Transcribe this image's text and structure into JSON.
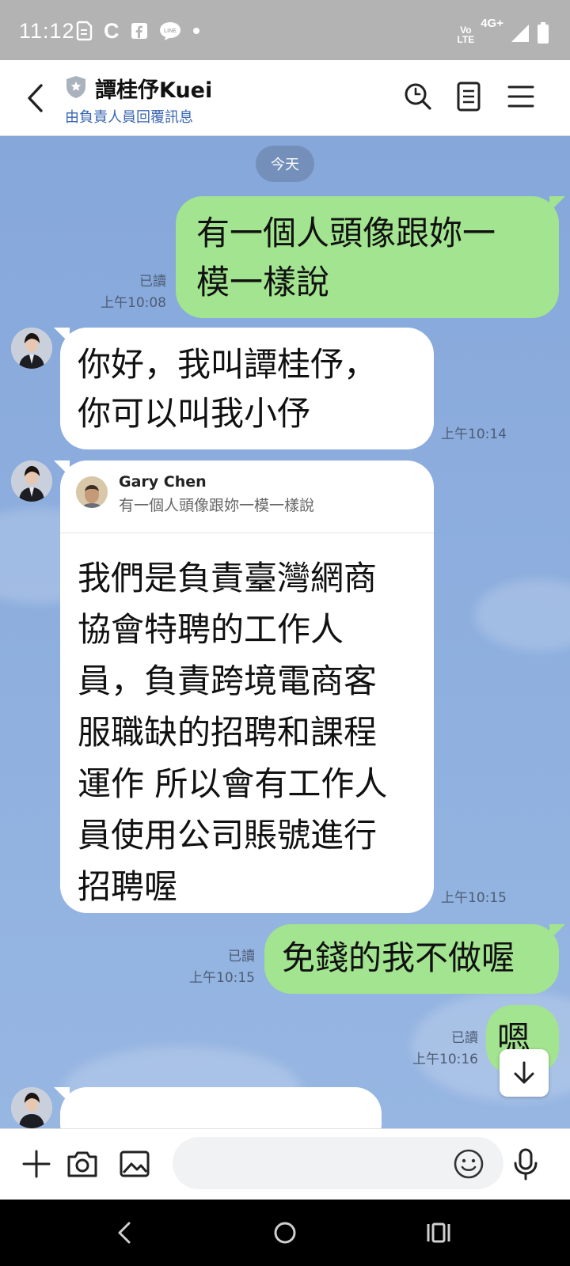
{
  "status_bar": {
    "time": "11:12",
    "network": "4G+",
    "volte_top": "Vo",
    "volte_bottom": "LTE",
    "icons": [
      "sim-card-icon",
      "c-app-icon",
      "facebook-icon",
      "line-icon",
      "dot-icon",
      "signal-icon",
      "battery-icon"
    ]
  },
  "header": {
    "title": "譚桂伃Kuei",
    "subtitle": "由負責人員回覆訊息",
    "badge_icon": "official-shield-icon",
    "buttons": [
      "search-icon",
      "notes-icon",
      "menu-icon"
    ]
  },
  "chat": {
    "date_label": "今天",
    "messages": [
      {
        "sender": "me",
        "text_lines": [
          "有一個人頭像跟妳一",
          "模一樣說"
        ],
        "read": "已讀",
        "time": "上午10:08"
      },
      {
        "sender": "them",
        "text_lines": [
          "你好，我叫譚桂伃，",
          "你可以叫我小伃"
        ],
        "time": "上午10:14"
      },
      {
        "sender": "them",
        "reply_to": {
          "name": "Gary Chen",
          "text": "有一個人頭像跟妳一模一樣說"
        },
        "text_lines": [
          "我們是負責臺灣網商",
          "協會特聘的工作人",
          "員，負責跨境電商客",
          "服職缺的招聘和課程",
          "運作 所以會有工作人",
          "員使用公司賬號進行",
          "招聘喔"
        ],
        "time": "上午10:15"
      },
      {
        "sender": "me",
        "text_lines": [
          "免錢的我不做喔"
        ],
        "read": "已讀",
        "time": "上午10:15"
      },
      {
        "sender": "me",
        "text_lines": [
          "嗯"
        ],
        "read": "已讀",
        "time": "上午10:16"
      }
    ]
  },
  "input_bar": {
    "placeholder": "",
    "buttons": [
      "plus-icon",
      "camera-icon",
      "image-icon",
      "emoji-icon",
      "microphone-icon"
    ]
  },
  "nav_bar": {
    "buttons": [
      "back-nav-icon",
      "home-nav-icon",
      "recents-nav-icon"
    ]
  },
  "colors": {
    "my_bubble": "#a2e48f",
    "their_bubble": "#ffffff",
    "chat_background": "#8ea9d8",
    "link_blue": "#3a66b3"
  }
}
